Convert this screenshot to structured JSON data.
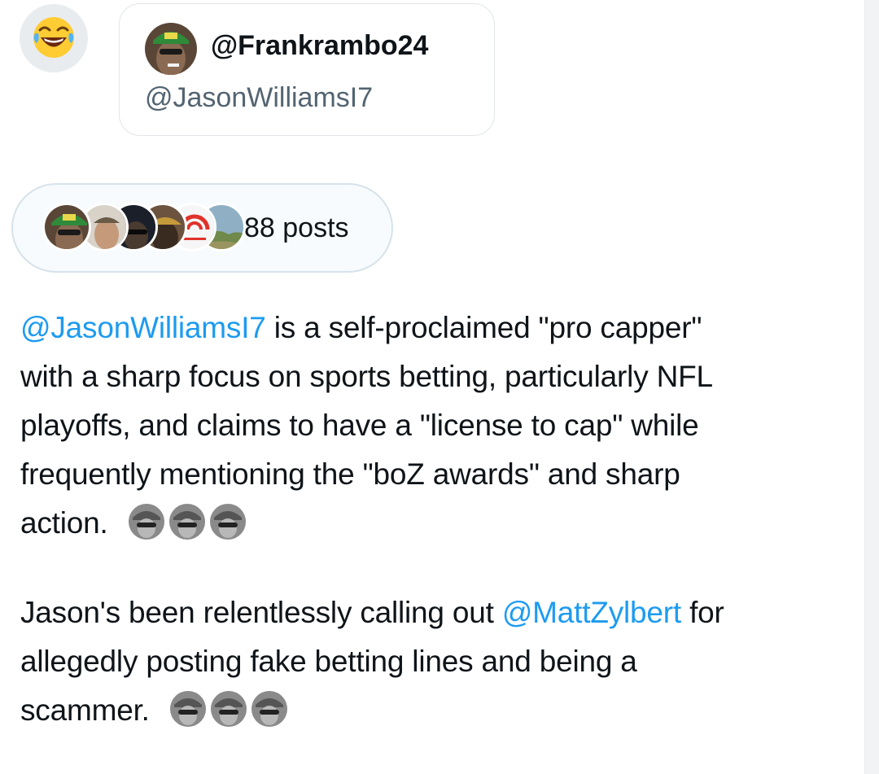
{
  "reaction": {
    "icon": "laughing-tears-emoji"
  },
  "mention_card": {
    "display_name": "@Frankrambo24",
    "handle": "@JasonWilliamsI7"
  },
  "posts_pill": {
    "count_label": "88 posts"
  },
  "summary": {
    "p1": {
      "mention": "@JasonWilliamsI7",
      "line1_rest": " is a self-proclaimed \"pro capper\"",
      "line2": "with a sharp focus on sports betting, particularly NFL",
      "line3": "playoffs, and claims to have a \"license to cap\" while",
      "line4": "frequently mentioning the \"boZ awards\" and sharp",
      "line5": "action."
    },
    "p2": {
      "line1_start": "Jason's been relentlessly calling out ",
      "mention": "@MattZylbert",
      "line1_end": " for",
      "line2": "allegedly posting fake betting lines and being a",
      "line3": "scammer."
    }
  },
  "colors": {
    "mention": "#1d9bf0",
    "text": "#0f1419",
    "secondary": "#536471"
  }
}
